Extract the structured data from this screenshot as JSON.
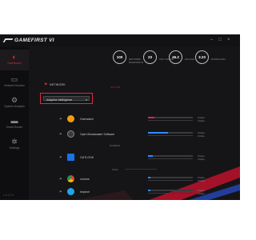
{
  "window": {
    "title": "GAMEFIRST VI"
  },
  "window_controls": {
    "minimize": "–",
    "maximize": "□",
    "close": "×"
  },
  "sidebar": {
    "items": [
      {
        "label": "Dashboard",
        "icon": "dashboard-icon",
        "glyph": "◐",
        "active": true
      },
      {
        "label": "Network Monitor",
        "icon": "monitor-icon",
        "glyph": "▭",
        "active": false
      },
      {
        "label": "System Analysis",
        "icon": "analysis-icon",
        "glyph": "⚙",
        "active": false
      },
      {
        "label": "Smart Router",
        "icon": "router-icon",
        "glyph": "▬",
        "active": false
      },
      {
        "label": "Settings",
        "icon": "settings-icon",
        "glyph": "✲",
        "active": false
      }
    ],
    "version": "v 6.1.0.0"
  },
  "stats": [
    {
      "value": "100",
      "label": "NETWORK BANDWIDTH"
    },
    {
      "value": "23",
      "label": "CPU USAGE"
    },
    {
      "value": "46.2",
      "label": "UPLOAD"
    },
    {
      "value": "3.23",
      "label": "DOWNLOAD"
    }
  ],
  "network": {
    "title": "NETWORK",
    "mode_value": "Adaptive Intelligence",
    "caret": "▾"
  },
  "groups": [
    {
      "label": "ACTIVE"
    },
    {
      "label": "NORMAL"
    },
    {
      "label": "IDLE"
    }
  ],
  "apps": [
    {
      "name": "Overwatch",
      "priority": "⚑",
      "icon_color": "#f39c12",
      "up": "0 kbps",
      "down": "0 kbps",
      "fill_color": "#e2253e",
      "fill": 0.15
    },
    {
      "name": "Open Broadcaster Software",
      "priority": "⚑",
      "icon_color": "#3a3a3a",
      "up": "0 kbps",
      "down": "0 kbps",
      "fill_color": "#2e8bff",
      "fill": 0.45
    },
    {
      "name": "OUTLOOK",
      "priority": "⚑",
      "icon_color": "#1a73e8",
      "up": "0 kbps",
      "down": "0 kbps",
      "fill_color": "#2e8bff",
      "fill": 0.1
    },
    {
      "name": "chrome",
      "priority": "⚑",
      "icon_color": "#3cba54",
      "up": "0 kbps",
      "down": "0 kbps",
      "fill_color": "#2e8bff",
      "fill": 0.05
    },
    {
      "name": "iexplore",
      "priority": "⚑",
      "icon_color": "#1ea7e6",
      "up": "0 kbps",
      "down": "0 kbps",
      "fill_color": "#2e8bff",
      "fill": 0.05
    }
  ]
}
